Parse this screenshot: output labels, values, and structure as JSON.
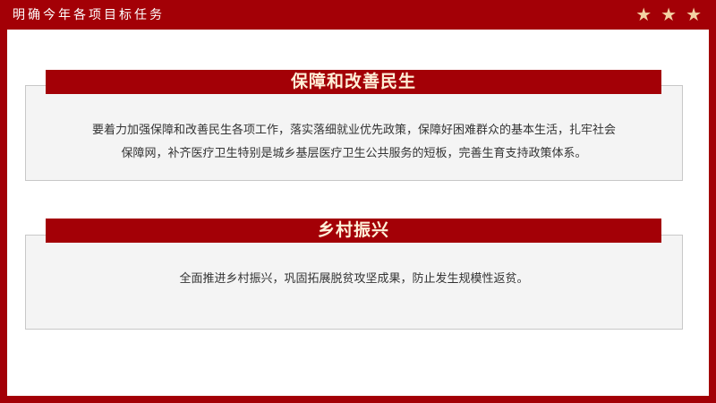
{
  "header": {
    "title": "明确今年各项目标任务",
    "stars": [
      "★",
      "★",
      "★"
    ]
  },
  "sections": [
    {
      "heading": "保障和改善民生",
      "lines": [
        "要着力加强保障和改善民生各项工作，落实落细就业优先政策，保障好困难群众的基本生活，扎牢社会",
        "保障网，补齐医疗卫生特别是城乡基层医疗卫生公共服务的短板，完善生育支持政策体系。"
      ]
    },
    {
      "heading": "乡村振兴",
      "lines": [
        "全面推进乡村振兴，巩固拓展脱贫攻坚成果，防止发生规模性返贫。"
      ]
    }
  ],
  "colors": {
    "primary_red": "#a30006",
    "ribbon_text": "#fff0d8",
    "star": "#f4d2a4",
    "panel_bg": "#f4f4f4",
    "body_text": "#333333"
  }
}
